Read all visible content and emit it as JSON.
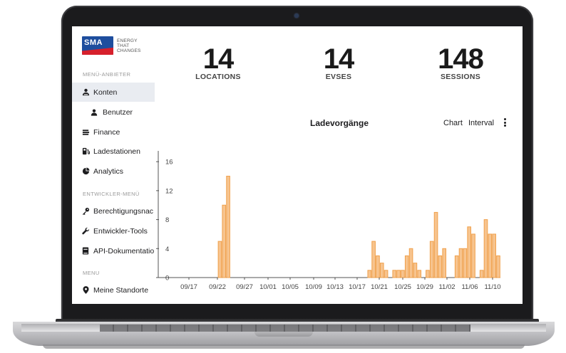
{
  "sidebar": {
    "logo": {
      "mark": "SMA",
      "tagline": [
        "ENERGY",
        "THAT",
        "CHANGES"
      ]
    },
    "sections": {
      "provider": "MENÜ-ANBIETER",
      "developer": "ENTWICKLER-MENÜ",
      "menu": "MENU"
    },
    "items": [
      {
        "label": "Konten",
        "icon": "users-icon",
        "active": true
      },
      {
        "label": "Benutzer",
        "icon": "user-icon",
        "sub": true
      },
      {
        "label": "Finance",
        "icon": "money-icon"
      },
      {
        "label": "Ladestationen",
        "icon": "charging-station-icon"
      },
      {
        "label": "Analytics",
        "icon": "pie-chart-icon"
      },
      {
        "label": "Berechtigungsnac",
        "icon": "key-icon"
      },
      {
        "label": "Entwickler-Tools",
        "icon": "wrench-icon"
      },
      {
        "label": "API-Dokumentatio",
        "icon": "book-icon"
      },
      {
        "label": "Meine Standorte",
        "icon": "map-pin-icon"
      }
    ]
  },
  "stats": [
    {
      "value": "14",
      "label": "LOCATIONS"
    },
    {
      "value": "14",
      "label": "EVSES"
    },
    {
      "value": "148",
      "label": "SESSIONS"
    }
  ],
  "chart_header": {
    "title": "Ladevorgänge",
    "chart_label": "Chart",
    "interval_label": "Interval",
    "menu_icon": "more-vertical-icon"
  },
  "chart_data": {
    "type": "bar",
    "title": "Ladevorgänge",
    "ylim": [
      0,
      17
    ],
    "yticks": [
      0,
      4,
      8,
      12,
      16
    ],
    "xtick_labels": [
      "09/17",
      "09/22",
      "09/27",
      "10/01",
      "10/05",
      "10/09",
      "10/13",
      "10/17",
      "10/21",
      "10/25",
      "10/29",
      "11/02",
      "11/06",
      "11/10"
    ],
    "bar_color": "#f7c48f",
    "bar_edge_color": "#f0a04b",
    "grid": false,
    "values": [
      0,
      0,
      0,
      0,
      0,
      0,
      0,
      0,
      0,
      0,
      0,
      0,
      0,
      0,
      5,
      10,
      14,
      0,
      0,
      0,
      0,
      0,
      0,
      0,
      0,
      0,
      0,
      0,
      0,
      0,
      0,
      0,
      0,
      0,
      0,
      0,
      0,
      0,
      0,
      0,
      0,
      0,
      0,
      0,
      0,
      0,
      0,
      0,
      0,
      0,
      1,
      5,
      3,
      2,
      1,
      0,
      1,
      1,
      1,
      3,
      4,
      2,
      1,
      0,
      1,
      5,
      9,
      3,
      4,
      0,
      0,
      3,
      4,
      4,
      7,
      6,
      0,
      1,
      8,
      6,
      6,
      3
    ]
  }
}
